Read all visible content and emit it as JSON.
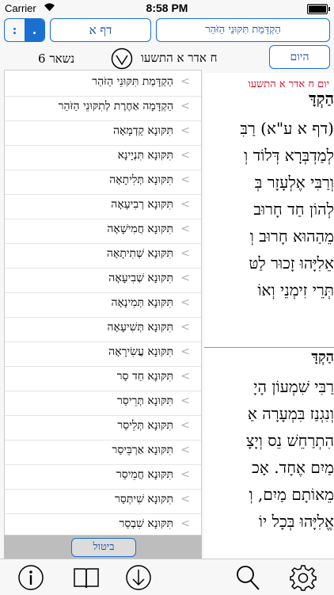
{
  "status_bar": {
    "carrier": "Carrier",
    "time": "8:58 PM"
  },
  "header": {
    "segment": {
      "left": ":",
      "right": "."
    },
    "daf_label": "דף א",
    "title_label": "הַקְדָּמַת תִּקּוּנֵי הַזֹּהַר"
  },
  "row2": {
    "remaining": "נשאר 6",
    "date": "ח אדר א התשעו",
    "today_label": "היום"
  },
  "text_pane": {
    "date_red": "יום ח אדר א התשעו",
    "lines": [
      "הַקְדָּ",
      "(דף א ע\"א) רַבִּ",
      "לְמַדְבְּרָא דְּלוֹד וְ",
      "וְרַבִּי אֶלְעָזָר בְּ",
      "לְהוֹן חַד חָרוּב",
      "מֵהַהוּא חָרוּב וְ",
      "אֵלִיָּהוּ זָכוּר לַטּ",
      "תְּרֵי זִימְנֵי וְאוֹ",
      "הַקְדָּ",
      "רַבִּי שִׁמְעוֹן הָיָ",
      "וְנִגְנַז בִּמְעָרָה אַ",
      "הִתְרַחֵשׁ נֵס וְיָצָ",
      "מַיִם אֶחָד. אָכ",
      "מֵאוֹתָם מַיִם, וְ",
      "אֱלִיָּהוּ בְּכָל יוֹ"
    ]
  },
  "list": {
    "items": [
      "הַקְדָּמַת תִּקּוּנֵי הַזֹּהַר",
      "הַקְדָּמָה אַחֶרֶת לְתִקּוּנֵי הַזֹּהַר",
      "תִּקּוּנָא קַדְמָאָה",
      "תִּקּוּנָא תִּנְיָינָא",
      "תִּקּוּנָא תְּלִיתָאָה",
      "תִּקּוּנָא רְבִיעָאָה",
      "תִּקּוּנָא חֲמִישָׁאָה",
      "תִּקּוּנָא שְׁתִיתָאָה",
      "תִּקּוּנָא שְׁבִיעָאָה",
      "תִּקּוּנָא תְּמִינָאָה",
      "תִּקּוּנָא תְּשִׁיעָאָה",
      "תִּקּוּנָא עֲשִׂירָאָה",
      "תִּקּוּנָא חַד סַר",
      "תִּקּוּנָא תְּרֵיסַר",
      "תִּקּוּנָא תְּלֵיסַר",
      "תִּקּוּנָא אַרְבֵּיסַר",
      "תִּקּוּנָא חֲמֵיסַר",
      "תִּקּוּנָא שִׁיתְּסַר",
      "תִּקּוּנָא שִׁבְסַר"
    ],
    "cancel_label": "ביטול"
  },
  "toolbar": {
    "icons": [
      "info-icon",
      "book-icon",
      "download-icon",
      "search-icon",
      "gear-icon"
    ]
  },
  "colors": {
    "accent": "#1b6fd1",
    "date_red": "#d0021b"
  }
}
